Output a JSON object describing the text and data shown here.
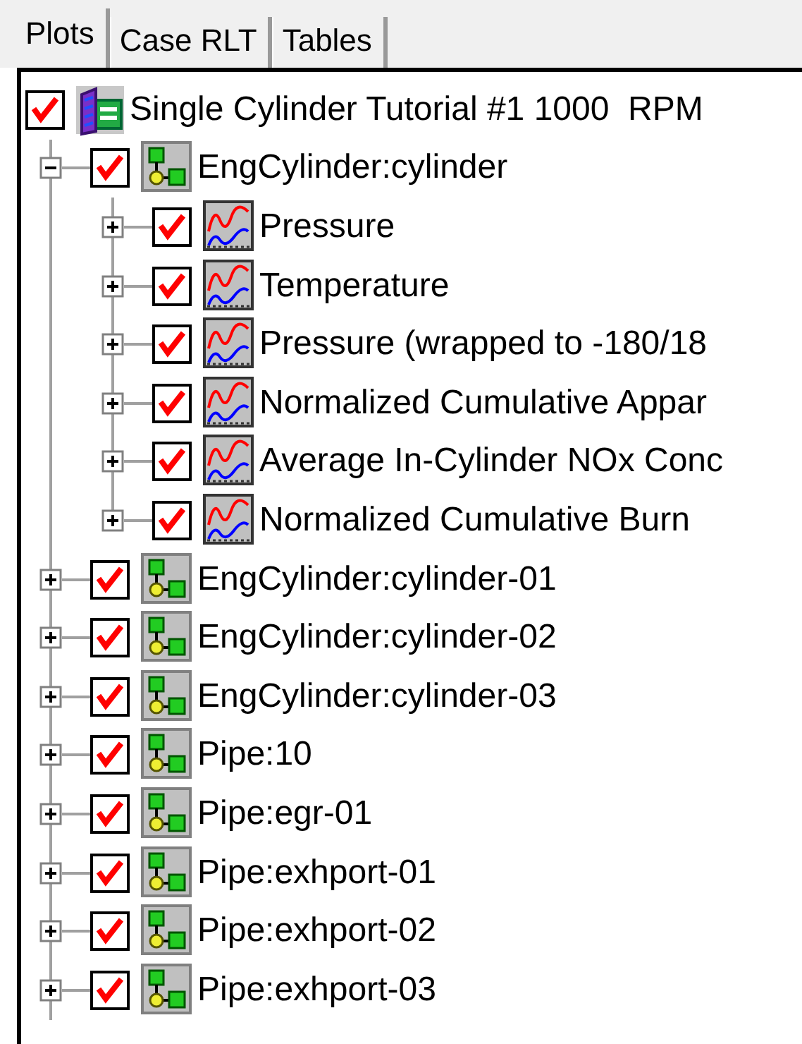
{
  "tabs": [
    {
      "label": "Plots",
      "selected": true
    },
    {
      "label": "Case RLT",
      "selected": false
    },
    {
      "label": "Tables",
      "selected": false
    }
  ],
  "tree": {
    "label": "Single Cylinder Tutorial #1 1000  RPM",
    "kind": "run",
    "checked": true,
    "children": [
      {
        "label": "EngCylinder:cylinder",
        "kind": "group",
        "checked": true,
        "expanded": true,
        "children": [
          {
            "label": "Pressure",
            "kind": "plot",
            "checked": true,
            "expanded": false
          },
          {
            "label": "Temperature",
            "kind": "plot",
            "checked": true,
            "expanded": false
          },
          {
            "label": "Pressure (wrapped to -180/18",
            "kind": "plot",
            "checked": true,
            "expanded": false
          },
          {
            "label": "Normalized Cumulative Appar",
            "kind": "plot",
            "checked": true,
            "expanded": false
          },
          {
            "label": "Average In-Cylinder NOx Conc",
            "kind": "plot",
            "checked": true,
            "expanded": false
          },
          {
            "label": "Normalized Cumulative Burn",
            "kind": "plot",
            "checked": true,
            "expanded": false
          }
        ]
      },
      {
        "label": "EngCylinder:cylinder-01",
        "kind": "group",
        "checked": true,
        "expanded": false
      },
      {
        "label": "EngCylinder:cylinder-02",
        "kind": "group",
        "checked": true,
        "expanded": false
      },
      {
        "label": "EngCylinder:cylinder-03",
        "kind": "group",
        "checked": true,
        "expanded": false
      },
      {
        "label": "Pipe:10",
        "kind": "group",
        "checked": true,
        "expanded": false
      },
      {
        "label": "Pipe:egr-01",
        "kind": "group",
        "checked": true,
        "expanded": false
      },
      {
        "label": "Pipe:exhport-01",
        "kind": "group",
        "checked": true,
        "expanded": false
      },
      {
        "label": "Pipe:exhport-02",
        "kind": "group",
        "checked": true,
        "expanded": false
      },
      {
        "label": "Pipe:exhport-03",
        "kind": "group",
        "checked": true,
        "expanded": false
      }
    ]
  }
}
